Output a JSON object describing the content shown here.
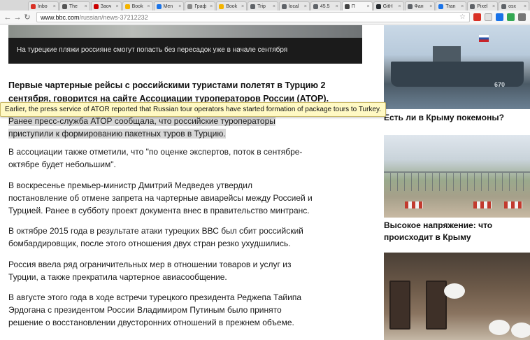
{
  "browser": {
    "tabs": [
      {
        "label": "Inbo",
        "color": "#d93025"
      },
      {
        "label": "The",
        "color": "#555555"
      },
      {
        "label": "Заоч",
        "color": "#cc0000"
      },
      {
        "label": "Book",
        "color": "#f4b400"
      },
      {
        "label": "Men",
        "color": "#1a73e8"
      },
      {
        "label": "Граф",
        "color": "#888888"
      },
      {
        "label": "Book",
        "color": "#f4b400"
      },
      {
        "label": "Trip",
        "color": "#5f6368"
      },
      {
        "label": "local",
        "color": "#5f6368"
      },
      {
        "label": "45.5",
        "color": "#5f6368"
      },
      {
        "label": "П",
        "color": "#444444",
        "active": true
      },
      {
        "label": "GitH",
        "color": "#24292e"
      },
      {
        "label": "Фан",
        "color": "#5f6368"
      },
      {
        "label": "Tran",
        "color": "#1a73e8"
      },
      {
        "label": "Pixel",
        "color": "#5f6368"
      },
      {
        "label": "osx",
        "color": "#5f6368"
      }
    ],
    "url_host": "www.bbc.com",
    "url_path": "/russian/news-37212232"
  },
  "article": {
    "caption": "На турецкие пляжи россияне смогут попасть без пересадок уже в начале сентября",
    "lead_line1": "Первые чартерные рейсы с российскими туристами полетят в Турцию 2",
    "lead_line2": "сентября, говорится на сайте Ассоциации туроператоров России (АТОР).",
    "p2_line1": "Ранее пресс-служба АТОР сообщала, что российские туроператоры",
    "p2_line2": "приступили к формированию пакетных туров в Турцию.",
    "p3_line1": "В ассоциации также отметили, что \"по оценке экспертов, поток в сентябре-",
    "p3_line2": "октябре будет небольшим\".",
    "p4_line1": "В воскресенье премьер-министр Дмитрий Медведев утвердил",
    "p4_line2": "постановление об отмене запрета на чартерные авиарейсы между Россией и",
    "p4_line3": "Турцией. Ранее в субботу проект документа внес в правительство минтранс.",
    "p5_line1": "В октябре 2015 года в результате атаки турецких ВВС был сбит российский",
    "p5_line2": "бомбардировщик, после этого отношения двух стран резко ухудшились.",
    "p6_line1": "Россия ввела ряд ограничительных мер в отношении товаров и услуг из",
    "p6_line2": "Турции, а также прекратила чартерное авиасообщение.",
    "p7_line1": "В августе этого года в ходе встречи турецкого президента Реджепа Тайипа",
    "p7_line2": "Эрдогана с президентом России Владимиром Путиным было принято",
    "p7_line3": "решение о восстановлении двусторонних отношений в прежнем объеме."
  },
  "tooltip": {
    "text": "Earlier, the press service of ATOR reported that Russian tour operators have started formation of package tours to Turkey."
  },
  "sidebar": {
    "ship_number": "670",
    "headline1": "Есть ли в Крыму покемоны?",
    "headline2_line1": "Высокое напряжение: что",
    "headline2_line2": "происходит в Крыму"
  }
}
